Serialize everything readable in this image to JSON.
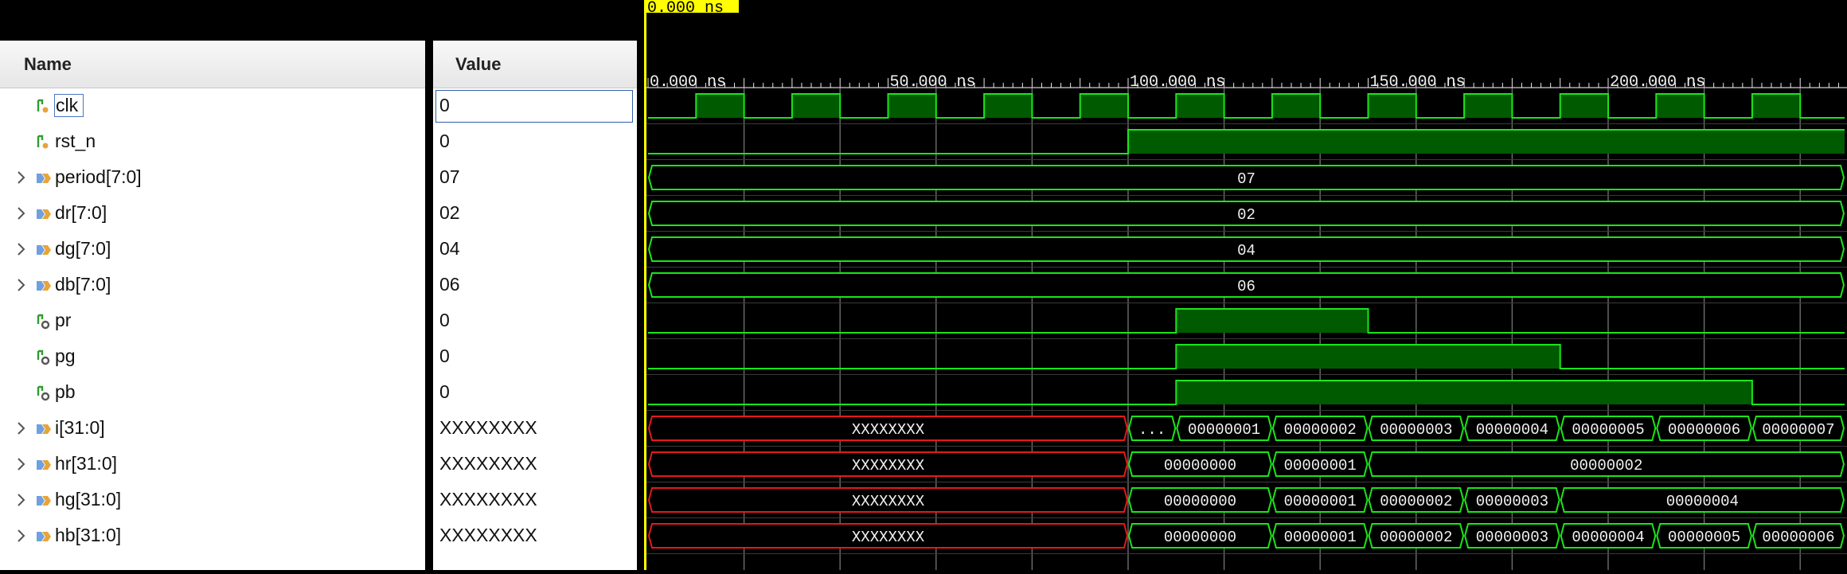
{
  "colors": {
    "wave_line": "#19e619",
    "wave_fill": "#005a00",
    "undefined": "#e61919",
    "grid": "#6e6e6e",
    "cursor": "#ffff00",
    "header_bg": "#efefef"
  },
  "headers": {
    "name": "Name",
    "value": "Value"
  },
  "cursor_label": "0.000 ns",
  "timeline": {
    "ticks": [
      {
        "t": 0,
        "label": "0.000 ns"
      },
      {
        "t": 50,
        "label": "50.000 ns"
      },
      {
        "t": 100,
        "label": "100.000 ns"
      },
      {
        "t": 150,
        "label": "150.000 ns"
      },
      {
        "t": 200,
        "label": "200.000 ns"
      }
    ],
    "range_ns": [
      0,
      250
    ]
  },
  "signals": [
    {
      "name": "clk",
      "value": "0",
      "icon": "bit-signal-icon",
      "expandable": false,
      "kind": "bit",
      "transitions": [
        [
          0,
          0
        ],
        [
          10,
          1
        ],
        [
          20,
          0
        ],
        [
          30,
          1
        ],
        [
          40,
          0
        ],
        [
          50,
          1
        ],
        [
          60,
          0
        ],
        [
          70,
          1
        ],
        [
          80,
          0
        ],
        [
          90,
          1
        ],
        [
          100,
          0
        ],
        [
          110,
          1
        ],
        [
          120,
          0
        ],
        [
          130,
          1
        ],
        [
          140,
          0
        ],
        [
          150,
          1
        ],
        [
          160,
          0
        ],
        [
          170,
          1
        ],
        [
          180,
          0
        ],
        [
          190,
          1
        ],
        [
          200,
          0
        ],
        [
          210,
          1
        ],
        [
          220,
          0
        ],
        [
          230,
          1
        ],
        [
          240,
          0
        ]
      ]
    },
    {
      "name": "rst_n",
      "value": "0",
      "icon": "bit-signal-icon",
      "expandable": false,
      "kind": "bit",
      "transitions": [
        [
          0,
          0
        ],
        [
          100,
          1
        ]
      ]
    },
    {
      "name": "period[7:0]",
      "value": "07",
      "icon": "bus-signal-icon",
      "expandable": true,
      "kind": "bus",
      "segments": [
        {
          "t0": 0,
          "t1": 250,
          "label": "07",
          "state": "valid"
        }
      ]
    },
    {
      "name": "dr[7:0]",
      "value": "02",
      "icon": "bus-signal-icon",
      "expandable": true,
      "kind": "bus",
      "segments": [
        {
          "t0": 0,
          "t1": 250,
          "label": "02",
          "state": "valid"
        }
      ]
    },
    {
      "name": "dg[7:0]",
      "value": "04",
      "icon": "bus-signal-icon",
      "expandable": true,
      "kind": "bus",
      "segments": [
        {
          "t0": 0,
          "t1": 250,
          "label": "04",
          "state": "valid"
        }
      ]
    },
    {
      "name": "db[7:0]",
      "value": "06",
      "icon": "bus-signal-icon",
      "expandable": true,
      "kind": "bus",
      "segments": [
        {
          "t0": 0,
          "t1": 250,
          "label": "06",
          "state": "valid"
        }
      ]
    },
    {
      "name": "pr",
      "value": "0",
      "icon": "output-bit-icon",
      "expandable": false,
      "kind": "bit",
      "transitions": [
        [
          0,
          0
        ],
        [
          110,
          1
        ],
        [
          150,
          0
        ]
      ]
    },
    {
      "name": "pg",
      "value": "0",
      "icon": "output-bit-icon",
      "expandable": false,
      "kind": "bit",
      "transitions": [
        [
          0,
          0
        ],
        [
          110,
          1
        ],
        [
          190,
          0
        ]
      ]
    },
    {
      "name": "pb",
      "value": "0",
      "icon": "output-bit-icon",
      "expandable": false,
      "kind": "bit",
      "transitions": [
        [
          0,
          0
        ],
        [
          110,
          1
        ],
        [
          230,
          0
        ]
      ]
    },
    {
      "name": "i[31:0]",
      "value": "XXXXXXXX",
      "icon": "bus-signal-icon",
      "expandable": true,
      "kind": "bus",
      "segments": [
        {
          "t0": 0,
          "t1": 100,
          "label": "XXXXXXXX",
          "state": "undefined"
        },
        {
          "t0": 100,
          "t1": 110,
          "label": "...",
          "state": "valid"
        },
        {
          "t0": 110,
          "t1": 130,
          "label": "00000001",
          "state": "valid"
        },
        {
          "t0": 130,
          "t1": 150,
          "label": "00000002",
          "state": "valid"
        },
        {
          "t0": 150,
          "t1": 170,
          "label": "00000003",
          "state": "valid"
        },
        {
          "t0": 170,
          "t1": 190,
          "label": "00000004",
          "state": "valid"
        },
        {
          "t0": 190,
          "t1": 210,
          "label": "00000005",
          "state": "valid"
        },
        {
          "t0": 210,
          "t1": 230,
          "label": "00000006",
          "state": "valid"
        },
        {
          "t0": 230,
          "t1": 250,
          "label": "00000007",
          "state": "valid"
        }
      ]
    },
    {
      "name": "hr[31:0]",
      "value": "XXXXXXXX",
      "icon": "bus-signal-icon",
      "expandable": true,
      "kind": "bus",
      "segments": [
        {
          "t0": 0,
          "t1": 100,
          "label": "XXXXXXXX",
          "state": "undefined"
        },
        {
          "t0": 100,
          "t1": 130,
          "label": "00000000",
          "state": "valid"
        },
        {
          "t0": 130,
          "t1": 150,
          "label": "00000001",
          "state": "valid"
        },
        {
          "t0": 150,
          "t1": 250,
          "label": "00000002",
          "state": "valid"
        }
      ]
    },
    {
      "name": "hg[31:0]",
      "value": "XXXXXXXX",
      "icon": "bus-signal-icon",
      "expandable": true,
      "kind": "bus",
      "segments": [
        {
          "t0": 0,
          "t1": 100,
          "label": "XXXXXXXX",
          "state": "undefined"
        },
        {
          "t0": 100,
          "t1": 130,
          "label": "00000000",
          "state": "valid"
        },
        {
          "t0": 130,
          "t1": 150,
          "label": "00000001",
          "state": "valid"
        },
        {
          "t0": 150,
          "t1": 170,
          "label": "00000002",
          "state": "valid"
        },
        {
          "t0": 170,
          "t1": 190,
          "label": "00000003",
          "state": "valid"
        },
        {
          "t0": 190,
          "t1": 250,
          "label": "00000004",
          "state": "valid"
        }
      ]
    },
    {
      "name": "hb[31:0]",
      "value": "XXXXXXXX",
      "icon": "bus-signal-icon",
      "expandable": true,
      "kind": "bus",
      "segments": [
        {
          "t0": 0,
          "t1": 100,
          "label": "XXXXXXXX",
          "state": "undefined"
        },
        {
          "t0": 100,
          "t1": 130,
          "label": "00000000",
          "state": "valid"
        },
        {
          "t0": 130,
          "t1": 150,
          "label": "00000001",
          "state": "valid"
        },
        {
          "t0": 150,
          "t1": 170,
          "label": "00000002",
          "state": "valid"
        },
        {
          "t0": 170,
          "t1": 190,
          "label": "00000003",
          "state": "valid"
        },
        {
          "t0": 190,
          "t1": 210,
          "label": "00000004",
          "state": "valid"
        },
        {
          "t0": 210,
          "t1": 230,
          "label": "00000005",
          "state": "valid"
        },
        {
          "t0": 230,
          "t1": 250,
          "label": "00000006",
          "state": "valid"
        }
      ]
    }
  ]
}
